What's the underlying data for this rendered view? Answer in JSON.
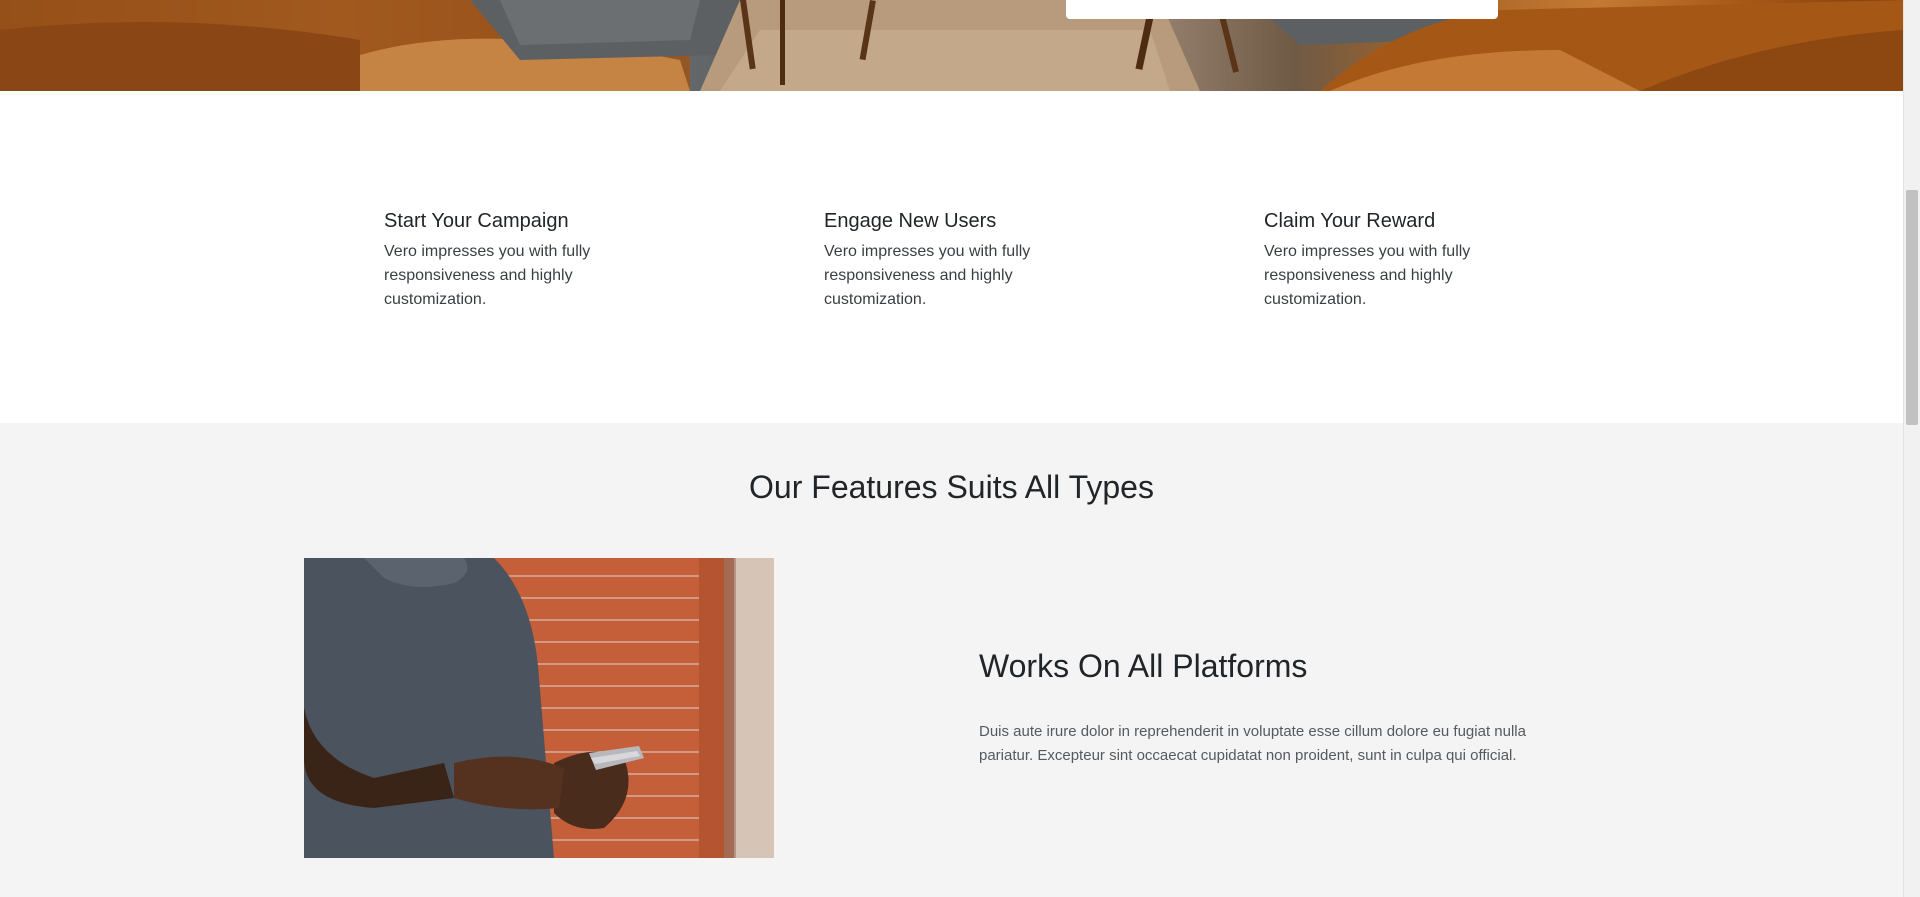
{
  "hero": {
    "image_alt": "hero-lounge-image"
  },
  "steps": [
    {
      "title": "Start Your Campaign",
      "text": "Vero impresses you with fully responsiveness and highly customization."
    },
    {
      "title": "Engage New Users",
      "text": "Vero impresses you with fully responsiveness and highly customization."
    },
    {
      "title": "Claim Your Reward",
      "text": "Vero impresses you with fully responsiveness and highly customization."
    }
  ],
  "features": {
    "title": "Our Features Suits All Types",
    "item": {
      "heading": "Works On All Platforms",
      "text": "Duis aute irure dolor in reprehenderit in voluptate esse cillum dolore eu fugiat nulla pariatur. Excepteur sint occaecat cupidatat non proident, sunt in culpa qui official."
    }
  },
  "colors": {
    "features_bg": "#f4f4f4",
    "text": "#212529"
  }
}
